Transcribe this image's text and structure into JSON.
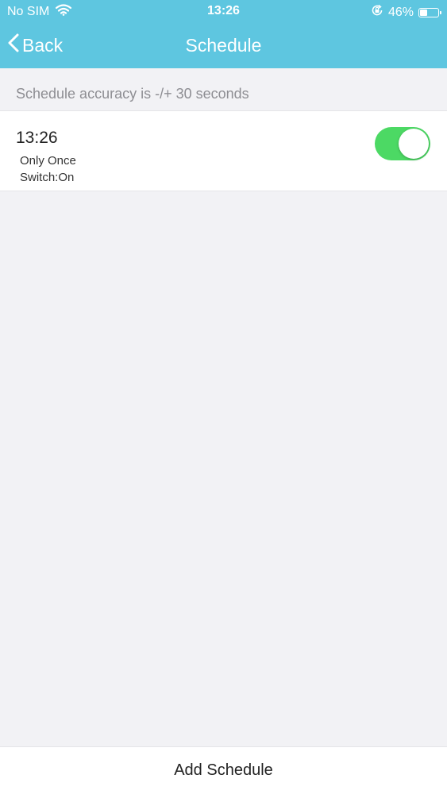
{
  "status_bar": {
    "carrier": "No SIM",
    "time": "13:26",
    "battery_percent_text": "46%",
    "battery_level": 0.46,
    "icons": [
      "wifi-icon",
      "orientation-lock-icon",
      "battery-icon"
    ]
  },
  "nav": {
    "back_label": "Back",
    "title": "Schedule",
    "icon": "chevron-left-icon"
  },
  "info": {
    "accuracy_text": "Schedule accuracy is -/+ 30 seconds"
  },
  "schedules": [
    {
      "time": "13:26",
      "repeat": "Only Once",
      "action": "Switch:On",
      "enabled": true
    }
  ],
  "footer": {
    "add_label": "Add Schedule"
  },
  "colors": {
    "header": "#5ec6e0",
    "toggle_on": "#4cd964",
    "background": "#f2f2f5"
  }
}
